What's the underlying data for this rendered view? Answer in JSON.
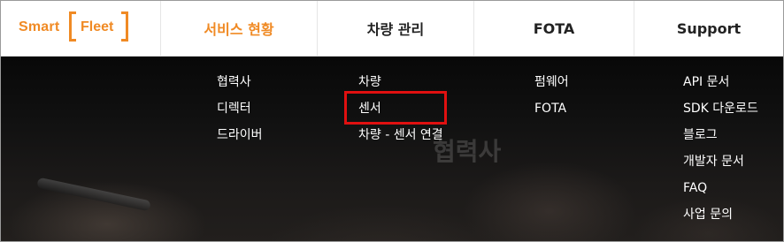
{
  "logo": {
    "part1": "Smart",
    "part2": "Fleet",
    "accent_color": "#f08a24"
  },
  "nav": {
    "tabs": [
      {
        "label": "서비스 현황",
        "active": true
      },
      {
        "label": "차량 관리",
        "active": false
      },
      {
        "label": "FOTA",
        "active": false
      },
      {
        "label": "Support",
        "active": false
      }
    ]
  },
  "dropdown": {
    "columns": [
      {
        "items": [
          "협력사",
          "디렉터",
          "드라이버"
        ]
      },
      {
        "items": [
          "차량",
          "센서",
          "차량 - 센서 연결"
        ]
      },
      {
        "items": [
          "펌웨어",
          "FOTA"
        ]
      },
      {
        "items": [
          "API 문서",
          "SDK 다운로드",
          "블로그",
          "개발자 문서",
          "FAQ",
          "사업 문의"
        ]
      }
    ],
    "background_watermark": "협력사",
    "highlight_color": "#e01010"
  }
}
